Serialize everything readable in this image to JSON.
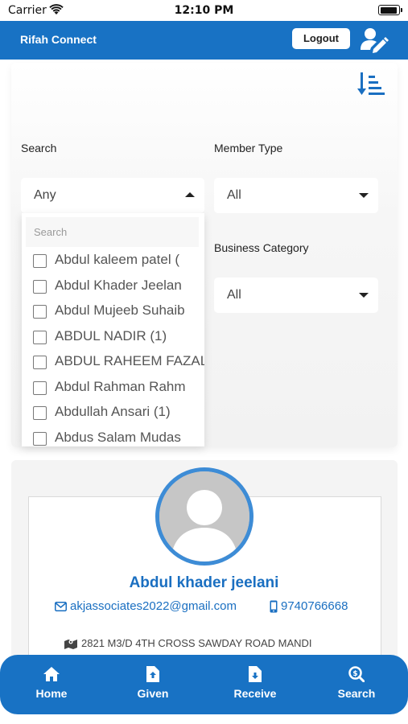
{
  "status_bar": {
    "carrier": "Carrier",
    "time": "12:10 PM"
  },
  "app_bar": {
    "title": "Rifah Connect",
    "logout_label": "Logout"
  },
  "filters": {
    "search_label": "Search",
    "search_value": "Any",
    "member_type_label": "Member Type",
    "member_type_value": "All",
    "business_category_label": "Business Category",
    "business_category_value": "All"
  },
  "dropdown": {
    "search_placeholder": "Search",
    "items": [
      {
        "label": "Abdul kaleem patel (",
        "checked": false
      },
      {
        "label": "Abdul Khader Jeelan",
        "checked": false
      },
      {
        "label": "Abdul Mujeeb Suhaib",
        "checked": false
      },
      {
        "label": "ABDUL NADIR (1)",
        "checked": false
      },
      {
        "label": "ABDUL RAHEEM FAZAL",
        "checked": false
      },
      {
        "label": "Abdul Rahman Rahm",
        "checked": false
      },
      {
        "label": "Abdullah Ansari (1)",
        "checked": false
      },
      {
        "label": "Abdus Salam Mudas",
        "checked": false
      }
    ]
  },
  "profile": {
    "name": "Abdul khader jeelani",
    "email": "akjassociates2022@gmail.com",
    "phone": "9740766668",
    "address": "2821 M3/D 4TH CROSS SAWDAY ROAD MANDI"
  },
  "bottom_nav": {
    "items": [
      {
        "label": "Home",
        "icon": "home-icon"
      },
      {
        "label": "Given",
        "icon": "file-upload-icon"
      },
      {
        "label": "Receive",
        "icon": "file-download-icon"
      },
      {
        "label": "Search",
        "icon": "search-dollar-icon"
      }
    ]
  },
  "colors": {
    "primary": "#1872c4",
    "link": "#1a6fc1",
    "avatar_ring": "#3d8cd6"
  }
}
